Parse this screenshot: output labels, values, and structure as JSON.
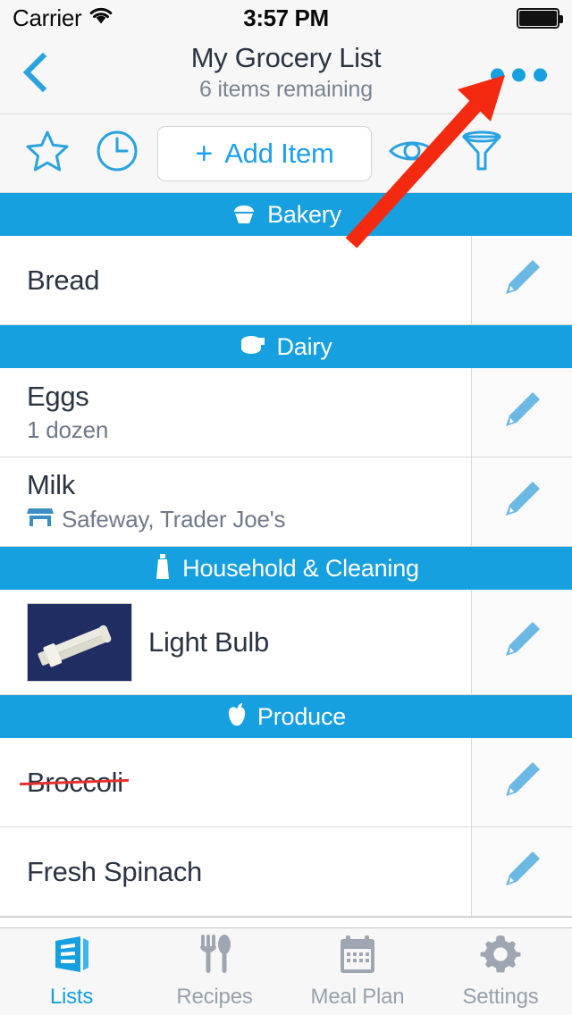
{
  "status_bar": {
    "carrier": "Carrier",
    "wifi_icon": "wifi-icon",
    "time": "3:57 PM",
    "battery_icon": "battery-full-icon"
  },
  "nav": {
    "back_icon": "chevron-left-icon",
    "title": "My Grocery List",
    "subtitle": "6 items remaining",
    "more_icon": "more-horizontal-icon"
  },
  "toolbar": {
    "favorite_icon": "star-icon",
    "recent_icon": "clock-icon",
    "add_plus": "+",
    "add_label": "Add Item",
    "show_hide_icon": "eye-icon",
    "filter_icon": "funnel-icon"
  },
  "sections": [
    {
      "label": "Bakery",
      "icon": "cupcake-icon",
      "items": [
        {
          "name": "Bread",
          "subtitle": "",
          "subtitle_icon": "",
          "completed": false,
          "thumb": false,
          "edit_icon": "pencil-icon"
        }
      ]
    },
    {
      "label": "Dairy",
      "icon": "cheese-icon",
      "items": [
        {
          "name": "Eggs",
          "subtitle": "1 dozen",
          "subtitle_icon": "",
          "completed": false,
          "thumb": false,
          "edit_icon": "pencil-icon"
        },
        {
          "name": "Milk",
          "subtitle": "Safeway, Trader Joe's",
          "subtitle_icon": "store-icon",
          "completed": false,
          "thumb": false,
          "edit_icon": "pencil-icon"
        }
      ]
    },
    {
      "label": "Household & Cleaning",
      "icon": "spray-bottle-icon",
      "items": [
        {
          "name": "Light Bulb",
          "subtitle": "",
          "subtitle_icon": "",
          "completed": false,
          "thumb": true,
          "thumb_alt": "compact-fluorescent-bulb-photo",
          "edit_icon": "pencil-icon"
        }
      ]
    },
    {
      "label": "Produce",
      "icon": "apple-icon",
      "items": [
        {
          "name": "Broccoli",
          "subtitle": "",
          "subtitle_icon": "",
          "completed": true,
          "thumb": false,
          "edit_icon": "pencil-icon"
        },
        {
          "name": "Fresh Spinach",
          "subtitle": "",
          "subtitle_icon": "",
          "completed": false,
          "thumb": false,
          "edit_icon": "pencil-icon"
        }
      ]
    }
  ],
  "tabs": [
    {
      "label": "Lists",
      "icon": "lists-icon",
      "active": true
    },
    {
      "label": "Recipes",
      "icon": "fork-spoon-icon",
      "active": false
    },
    {
      "label": "Meal Plan",
      "icon": "calendar-icon",
      "active": false
    },
    {
      "label": "Settings",
      "icon": "gear-icon",
      "active": false
    }
  ],
  "annotation": {
    "arrow_icon": "red-arrow-pointer",
    "points_to": "more-horizontal-icon"
  },
  "colors": {
    "accent_blue": "#17a0df",
    "link_blue": "#1c9fec",
    "section_blue": "#17a0df",
    "text_dark": "#2b3442",
    "text_muted": "#70798a",
    "tab_inactive": "#98a1ac",
    "strike_red": "#e8302e",
    "annotation_red": "#f42a10",
    "chrome_bg": "#f7f7f7"
  }
}
